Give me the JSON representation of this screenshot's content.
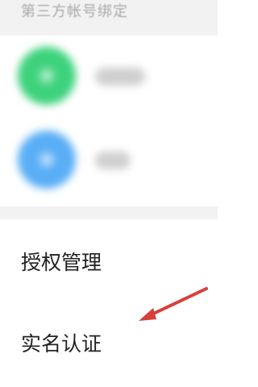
{
  "section": {
    "title": "第三方帐号绑定"
  },
  "bindings": [
    {
      "icon": "green-app-icon",
      "color": "#3dd27c"
    },
    {
      "icon": "blue-app-icon",
      "color": "#59aef6"
    }
  ],
  "menu": {
    "authorization_label": "授权管理",
    "real_name_label": "实名认证"
  },
  "annotation": {
    "arrow_color": "#d7403a"
  }
}
